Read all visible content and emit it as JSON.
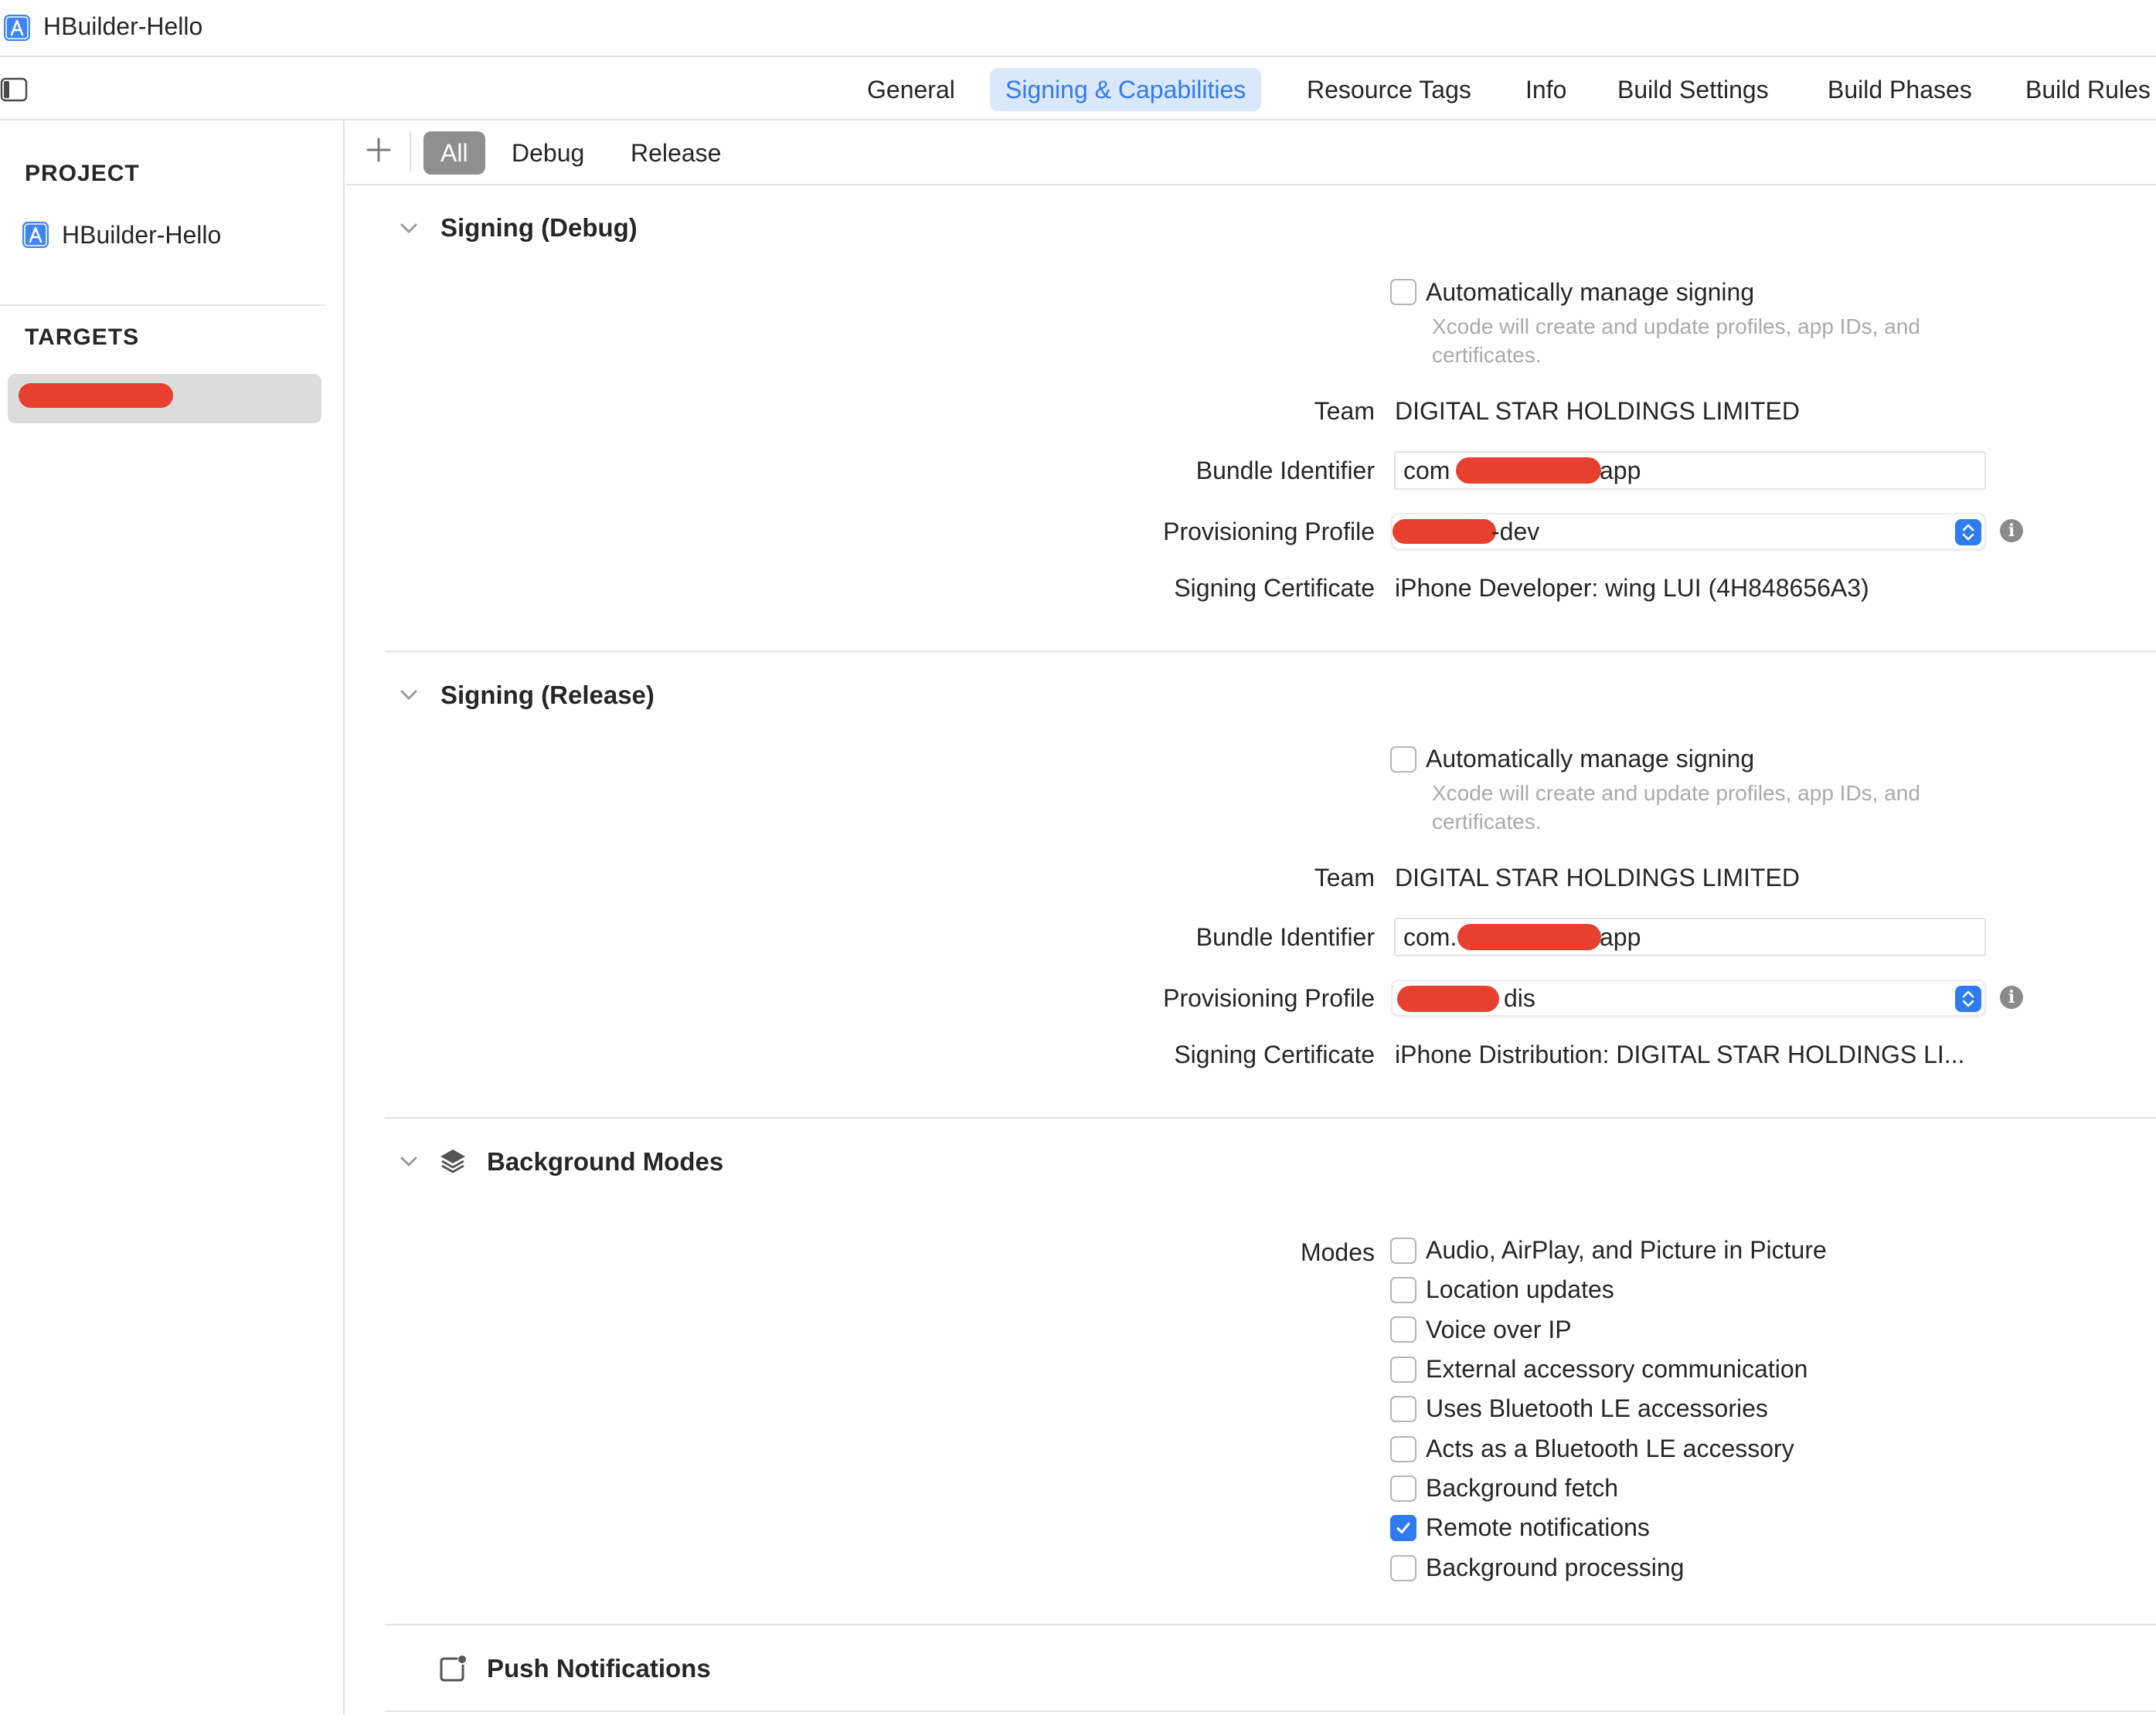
{
  "window": {
    "title": "HBuilder-Hello"
  },
  "tabs": [
    {
      "label": "General"
    },
    {
      "label": "Signing & Capabilities",
      "active": true
    },
    {
      "label": "Resource Tags"
    },
    {
      "label": "Info"
    },
    {
      "label": "Build Settings"
    },
    {
      "label": "Build Phases"
    },
    {
      "label": "Build Rules"
    }
  ],
  "sidebar": {
    "project_header": "PROJECT",
    "project_name": "HBuilder-Hello",
    "targets_header": "TARGETS"
  },
  "filter": {
    "segments": [
      {
        "label": "All",
        "active": true
      },
      {
        "label": "Debug"
      },
      {
        "label": "Release"
      }
    ]
  },
  "signing_debug": {
    "title": "Signing (Debug)",
    "auto_manage_label": "Automatically manage signing",
    "auto_manage_hint": "Xcode will create and update profiles, app IDs, and certificates.",
    "team_label": "Team",
    "team_value": "DIGITAL STAR HOLDINGS LIMITED",
    "bundle_label": "Bundle Identifier",
    "bundle_prefix": "com",
    "bundle_suffix": "app",
    "profile_label": "Provisioning Profile",
    "profile_suffix": "-dev",
    "cert_label": "Signing Certificate",
    "cert_value": "iPhone Developer: wing LUI (4H848656A3)"
  },
  "signing_release": {
    "title": "Signing (Release)",
    "auto_manage_label": "Automatically manage signing",
    "auto_manage_hint": "Xcode will create and update profiles, app IDs, and certificates.",
    "team_label": "Team",
    "team_value": "DIGITAL STAR HOLDINGS LIMITED",
    "bundle_label": "Bundle Identifier",
    "bundle_prefix": "com.",
    "bundle_suffix": "app",
    "profile_label": "Provisioning Profile",
    "profile_suffix": "dis",
    "cert_label": "Signing Certificate",
    "cert_value": "iPhone Distribution: DIGITAL STAR HOLDINGS LI..."
  },
  "background_modes": {
    "title": "Background Modes",
    "modes_label": "Modes",
    "modes": [
      {
        "label": "Audio, AirPlay, and Picture in Picture",
        "checked": false
      },
      {
        "label": "Location updates",
        "checked": false
      },
      {
        "label": "Voice over IP",
        "checked": false
      },
      {
        "label": "External accessory communication",
        "checked": false
      },
      {
        "label": "Uses Bluetooth LE accessories",
        "checked": false
      },
      {
        "label": "Acts as a Bluetooth LE accessory",
        "checked": false
      },
      {
        "label": "Background fetch",
        "checked": false
      },
      {
        "label": "Remote notifications",
        "checked": true
      },
      {
        "label": "Background processing",
        "checked": false
      }
    ]
  },
  "push_notifications": {
    "title": "Push Notifications"
  },
  "icons": {
    "app": "xcode-app-icon",
    "sidebar_toggle": "sidebar-toggle-icon",
    "add": "plus-icon",
    "disclosure": "chevron-down-icon",
    "layers": "layers-icon",
    "push": "push-notification-icon",
    "info": "info-icon",
    "popup": "stepper-icon"
  },
  "colors": {
    "accent": "#2f7bf0",
    "active_tab_bg": "#dbe8fb",
    "redaction": "#e8402f"
  }
}
